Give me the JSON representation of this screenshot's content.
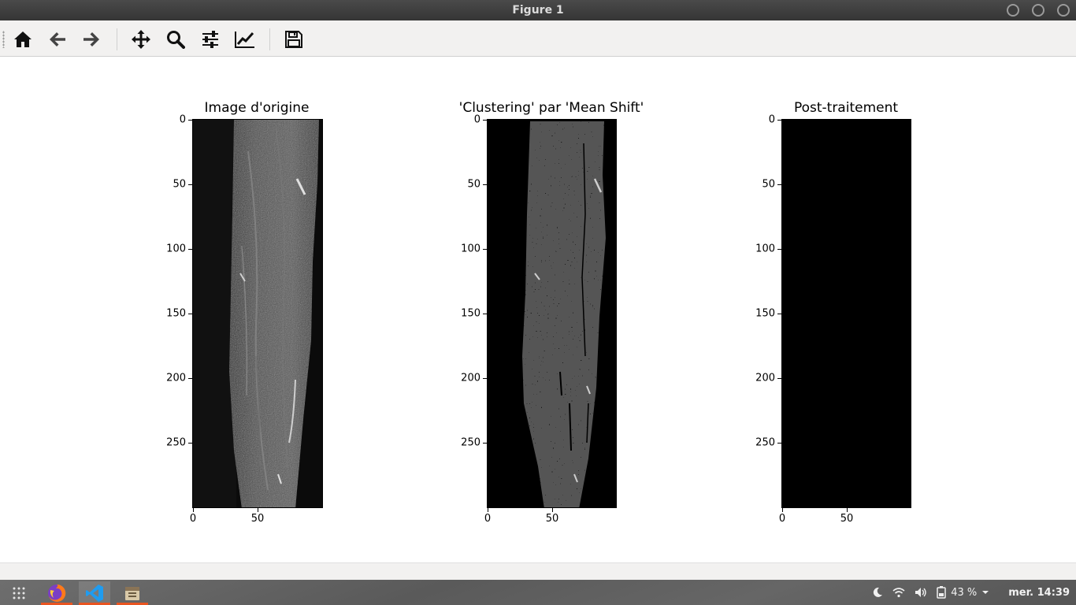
{
  "window": {
    "title": "Figure 1"
  },
  "toolbar": {
    "buttons": [
      {
        "icon": "home-icon"
      },
      {
        "icon": "back-arrow-icon"
      },
      {
        "icon": "forward-arrow-icon"
      },
      {
        "icon": "pan-move-icon"
      },
      {
        "icon": "zoom-magnifier-icon"
      },
      {
        "icon": "configure-subplots-icon"
      },
      {
        "icon": "edit-axis-curve-icon"
      },
      {
        "icon": "save-floppy-icon"
      }
    ]
  },
  "figure": {
    "subplots": [
      {
        "title": "Image d'origine",
        "y_ticks": [
          "0",
          "50",
          "100",
          "150",
          "200",
          "250"
        ],
        "x_ticks": [
          "0",
          "50"
        ]
      },
      {
        "title": "'Clustering' par 'Mean Shift'",
        "y_ticks": [
          "0",
          "50",
          "100",
          "150",
          "200",
          "250"
        ],
        "x_ticks": [
          "0",
          "50"
        ]
      },
      {
        "title": "Post-traitement",
        "y_ticks": [
          "0",
          "50",
          "100",
          "150",
          "200",
          "250"
        ],
        "x_ticks": [
          "0",
          "50"
        ]
      }
    ]
  },
  "taskbar": {
    "apps": [
      {
        "icon": "app-grid-icon"
      },
      {
        "icon": "firefox-icon"
      },
      {
        "icon": "vscode-icon"
      },
      {
        "icon": "file-archive-icon"
      }
    ],
    "tray": {
      "battery_percent": "43 %",
      "clock": "mer. 14:39"
    }
  },
  "colors": {
    "accent": "#e95420",
    "titlebar": "#3c3c3c",
    "toolbar": "#f2f1f0"
  }
}
